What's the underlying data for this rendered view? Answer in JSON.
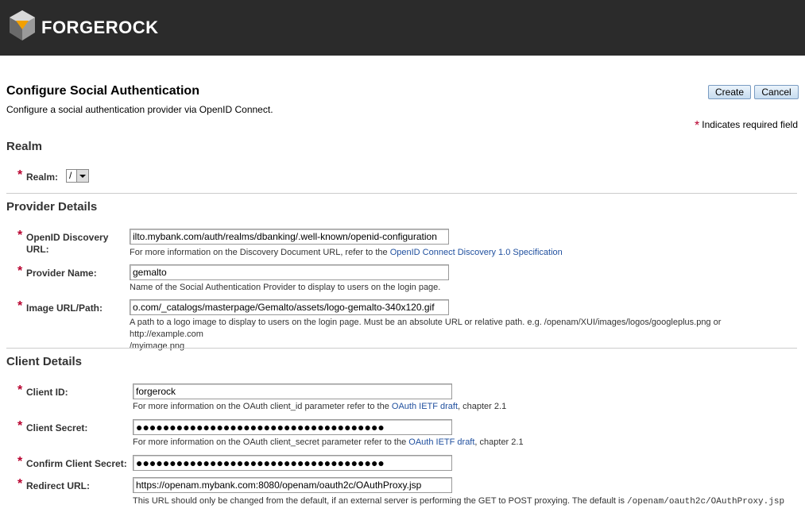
{
  "header": {
    "brand": "FORGEROCK",
    "logo_icon": "forgerock-logo-icon"
  },
  "page": {
    "title": "Configure Social Authentication",
    "subtitle": "Configure a social authentication provider via OpenID Connect.",
    "create_label": "Create",
    "cancel_label": "Cancel",
    "required_note": "Indicates required field"
  },
  "realm": {
    "heading": "Realm",
    "label": "Realm:",
    "value": "/"
  },
  "provider": {
    "heading": "Provider Details",
    "discovery_label_1": "OpenID Discovery",
    "discovery_label_2": "URL:",
    "discovery_value": "ilto.mybank.com/auth/realms/dbanking/.well-known/openid-configuration",
    "discovery_help": "For more information on the Discovery Document URL, refer to the",
    "discovery_link": "OpenID Connect Discovery 1.0 Specification",
    "name_label": "Provider Name:",
    "name_value": "gemalto",
    "name_help": "Name of the Social Authentication Provider to display to users on the login page.",
    "image_label": "Image URL/Path:",
    "image_value": "o.com/_catalogs/masterpage/Gemalto/assets/logo-gemalto-340x120.gif",
    "image_help_1": "A path to a logo image to display to users on the login page. Must be an absolute URL or relative path. e.g. /openam/XUI/images/logos/googleplus.png or http://example.com",
    "image_help_2": "/myimage.png"
  },
  "client": {
    "heading": "Client Details",
    "id_label": "Client ID:",
    "id_value": "forgerock",
    "id_help": "For more information on the OAuth client_id parameter refer to the",
    "id_link": "OAuth IETF draft",
    "id_help_tail": ", chapter 2.1",
    "secret_label": "Client Secret:",
    "secret_value": "●●●●●●●●●●●●●●●●●●●●●●●●●●●●●●●●●●●●●",
    "secret_help": "For more information on the OAuth client_secret parameter refer to the",
    "secret_link": "OAuth IETF draft",
    "secret_help_tail": ", chapter 2.1",
    "confirm_label": "Confirm Client Secret:",
    "confirm_value": "●●●●●●●●●●●●●●●●●●●●●●●●●●●●●●●●●●●●●",
    "redirect_label": "Redirect URL:",
    "redirect_value": "https://openam.mybank.com:8080/openam/oauth2c/OAuthProxy.jsp",
    "redirect_help": "This URL should only be changed from the default, if an external server is performing the GET to POST proxying. The default is",
    "redirect_default": "/openam/oauth2c/OAuthProxy.jsp"
  }
}
